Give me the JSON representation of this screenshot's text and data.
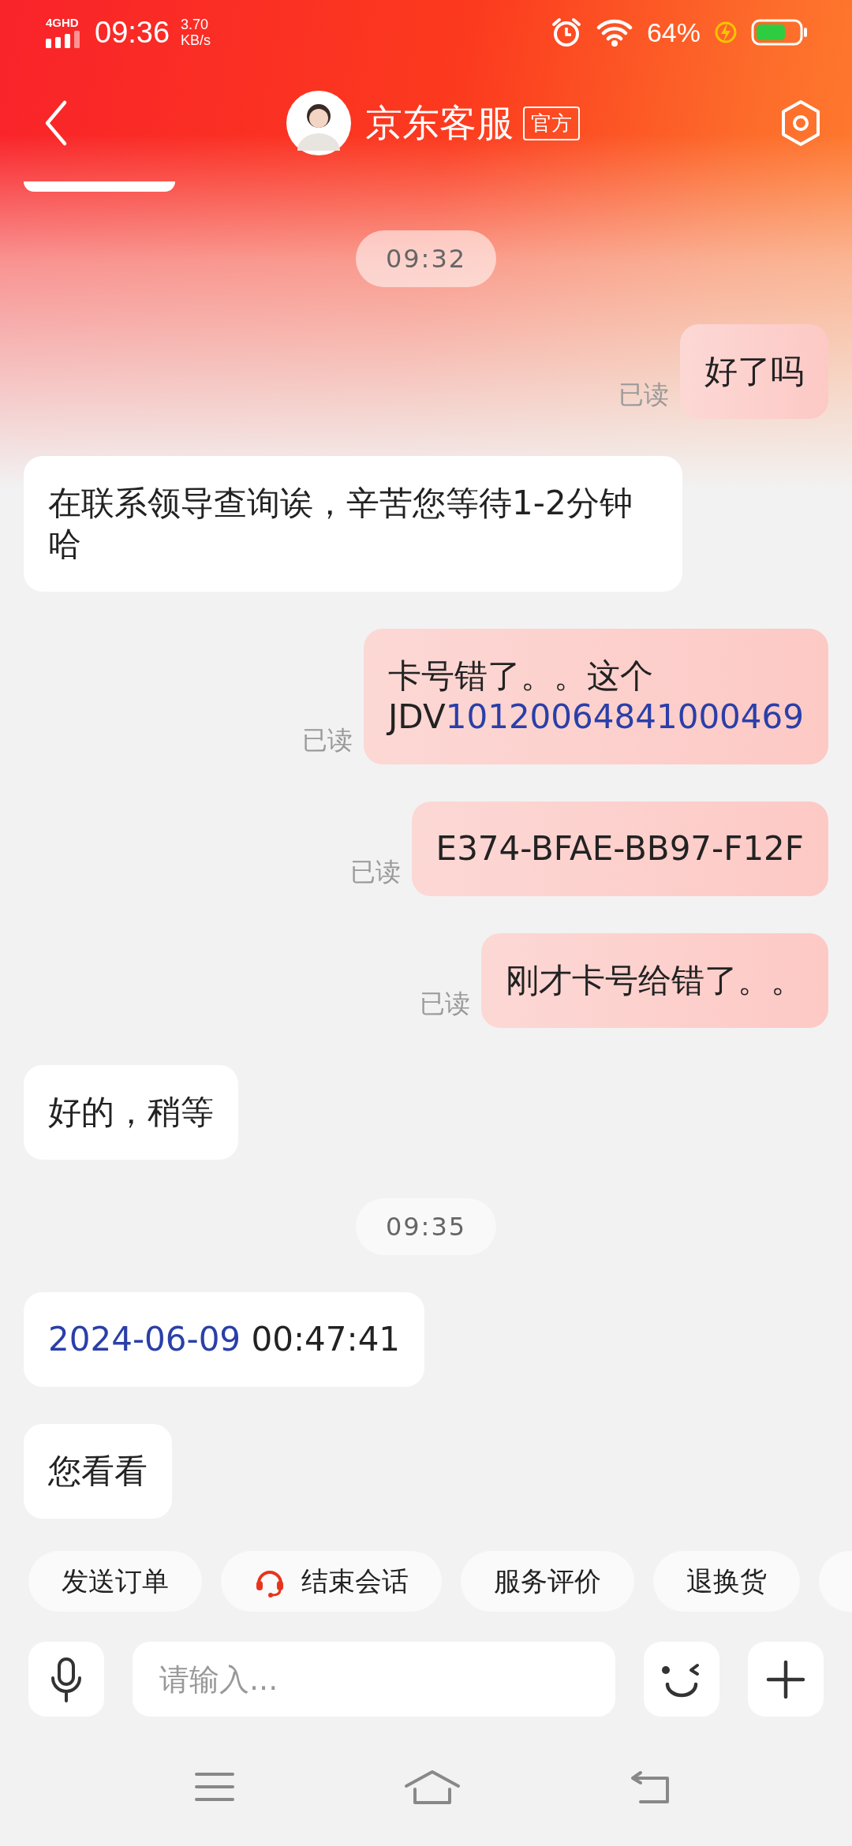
{
  "status_bar": {
    "network": "4GHD",
    "time": "09:36",
    "speed": "3.70",
    "speed_unit": "KB/s",
    "battery": "64%"
  },
  "header": {
    "title": "京东客服",
    "badge": "官方"
  },
  "messages": [
    {
      "kind": "partial"
    },
    {
      "kind": "time",
      "text": "09:32"
    },
    {
      "kind": "sent",
      "receipt": "已读",
      "parts": [
        {
          "text": "好了吗",
          "link": false
        }
      ]
    },
    {
      "kind": "received",
      "parts": [
        {
          "text": "在联系领导查询诶，辛苦您等待1-2分钟哈",
          "link": false
        }
      ]
    },
    {
      "kind": "sent",
      "receipt": "已读",
      "parts": [
        {
          "text": "卡号错了。。这个\nJDV",
          "link": false
        },
        {
          "text": "10120064841000469",
          "link": true
        }
      ]
    },
    {
      "kind": "sent",
      "receipt": "已读",
      "parts": [
        {
          "text": "E374-BFAE-BB97-F12F",
          "link": false
        }
      ]
    },
    {
      "kind": "sent",
      "receipt": "已读",
      "parts": [
        {
          "text": "刚才卡号给错了。。",
          "link": false
        }
      ]
    },
    {
      "kind": "received",
      "parts": [
        {
          "text": "好的，稍等",
          "link": false
        }
      ]
    },
    {
      "kind": "time",
      "text": "09:35"
    },
    {
      "kind": "received",
      "parts": [
        {
          "text": "2024-06-09",
          "link": true
        },
        {
          "text": "  00:47:41",
          "link": false
        }
      ]
    },
    {
      "kind": "received",
      "parts": [
        {
          "text": "您看看",
          "link": false
        }
      ]
    }
  ],
  "quick_replies": [
    {
      "kind": "plain",
      "label": "发送订单"
    },
    {
      "kind": "with-icon",
      "label": "结束会话"
    },
    {
      "kind": "plain",
      "label": "服务评价"
    },
    {
      "kind": "plain",
      "label": "退换货"
    },
    {
      "kind": "partial"
    }
  ],
  "input": {
    "placeholder": "请输入..."
  }
}
